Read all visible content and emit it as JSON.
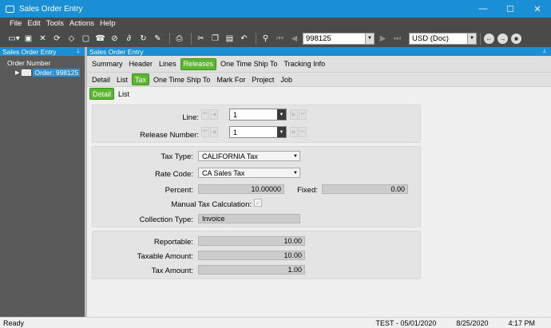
{
  "window": {
    "title": "Sales Order Entry"
  },
  "menu": [
    "File",
    "Edit",
    "Tools",
    "Actions",
    "Help"
  ],
  "toolbar": {
    "order_number": "998125",
    "currency": "USD (Doc)"
  },
  "left_panel": {
    "title": "Sales Order Entry",
    "tree_root": "Order Number",
    "tree_item": "Order: 998125"
  },
  "right_panel": {
    "title": "Sales Order Entry"
  },
  "tabs_level1": [
    "Summary",
    "Header",
    "Lines",
    "Releases",
    "One Time Ship To",
    "Tracking Info"
  ],
  "tabs_level2": [
    "Detail",
    "List",
    "Tax",
    "One Time Ship To",
    "Mark For",
    "Project",
    "Job"
  ],
  "tabs_level3": [
    "Detail",
    "List"
  ],
  "form": {
    "line_label": "Line:",
    "line_value": "1",
    "release_label": "Release Number:",
    "release_value": "1",
    "tax_type_label": "Tax Type:",
    "tax_type_value": "CALIFORNIA Tax",
    "rate_code_label": "Rate Code:",
    "rate_code_value": "CA Sales Tax",
    "percent_label": "Percent:",
    "percent_value": "10.00000",
    "fixed_label": "Fixed:",
    "fixed_value": "0.00",
    "manual_tax_label": "Manual Tax Calculation:",
    "collection_type_label": "Collection Type:",
    "collection_type_value": "Invoice",
    "reportable_label": "Reportable:",
    "reportable_value": "10.00",
    "taxable_amount_label": "Taxable Amount:",
    "taxable_amount_value": "10.00",
    "tax_amount_label": "Tax Amount:",
    "tax_amount_value": "1.00"
  },
  "status": {
    "left": "Ready",
    "user": "TEST - 05/01/2020",
    "date": "8/25/2020",
    "time": "4:17 PM"
  },
  "colors": {
    "title_blue": "#1a8fd6",
    "active_tab_green": "#5cb630",
    "dark_bar": "#4a4a4a"
  }
}
